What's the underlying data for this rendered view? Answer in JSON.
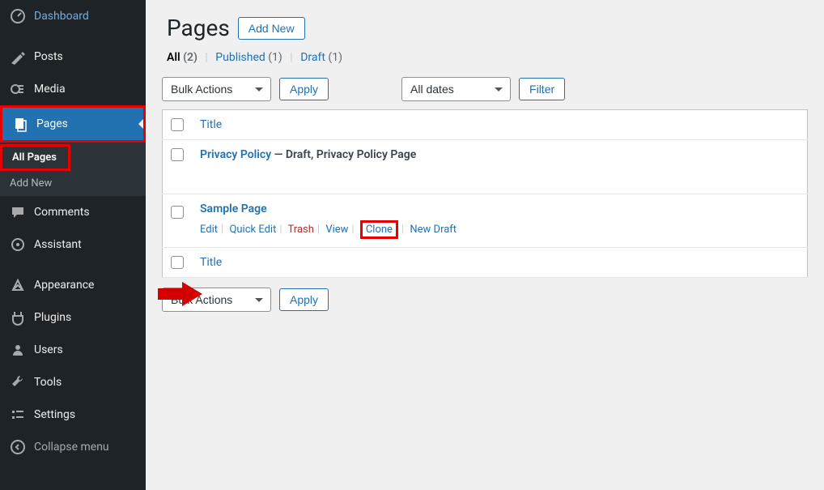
{
  "sidebar": {
    "items": [
      {
        "label": "Dashboard",
        "icon": "dashboard"
      },
      {
        "label": "Posts",
        "icon": "posts"
      },
      {
        "label": "Media",
        "icon": "media"
      },
      {
        "label": "Pages",
        "icon": "pages",
        "active": true
      },
      {
        "label": "Comments",
        "icon": "comments"
      },
      {
        "label": "Assistant",
        "icon": "assistant"
      },
      {
        "label": "Appearance",
        "icon": "appearance"
      },
      {
        "label": "Plugins",
        "icon": "plugins"
      },
      {
        "label": "Users",
        "icon": "users"
      },
      {
        "label": "Tools",
        "icon": "tools"
      },
      {
        "label": "Settings",
        "icon": "settings"
      }
    ],
    "submenu": [
      {
        "label": "All Pages",
        "current": true
      },
      {
        "label": "Add New"
      }
    ],
    "collapse": "Collapse menu"
  },
  "header": {
    "title": "Pages",
    "add_new": "Add New"
  },
  "filters": {
    "all_label": "All",
    "all_count": "(2)",
    "published_label": "Published",
    "published_count": "(1)",
    "draft_label": "Draft",
    "draft_count": "(1)"
  },
  "bulk": {
    "label": "Bulk Actions",
    "apply": "Apply"
  },
  "date_filter": {
    "label": "All dates",
    "filter": "Filter"
  },
  "table": {
    "title_col": "Title",
    "rows": [
      {
        "title": "Privacy Policy",
        "state": " — Draft, Privacy Policy Page"
      },
      {
        "title": "Sample Page"
      }
    ],
    "row_actions": {
      "edit": "Edit",
      "quick_edit": "Quick Edit",
      "trash": "Trash",
      "view": "View",
      "clone": "Clone",
      "new_draft": "New Draft"
    }
  },
  "colors": {
    "link": "#2271b1",
    "trash": "#b32d2e",
    "highlight": "#e60000"
  }
}
